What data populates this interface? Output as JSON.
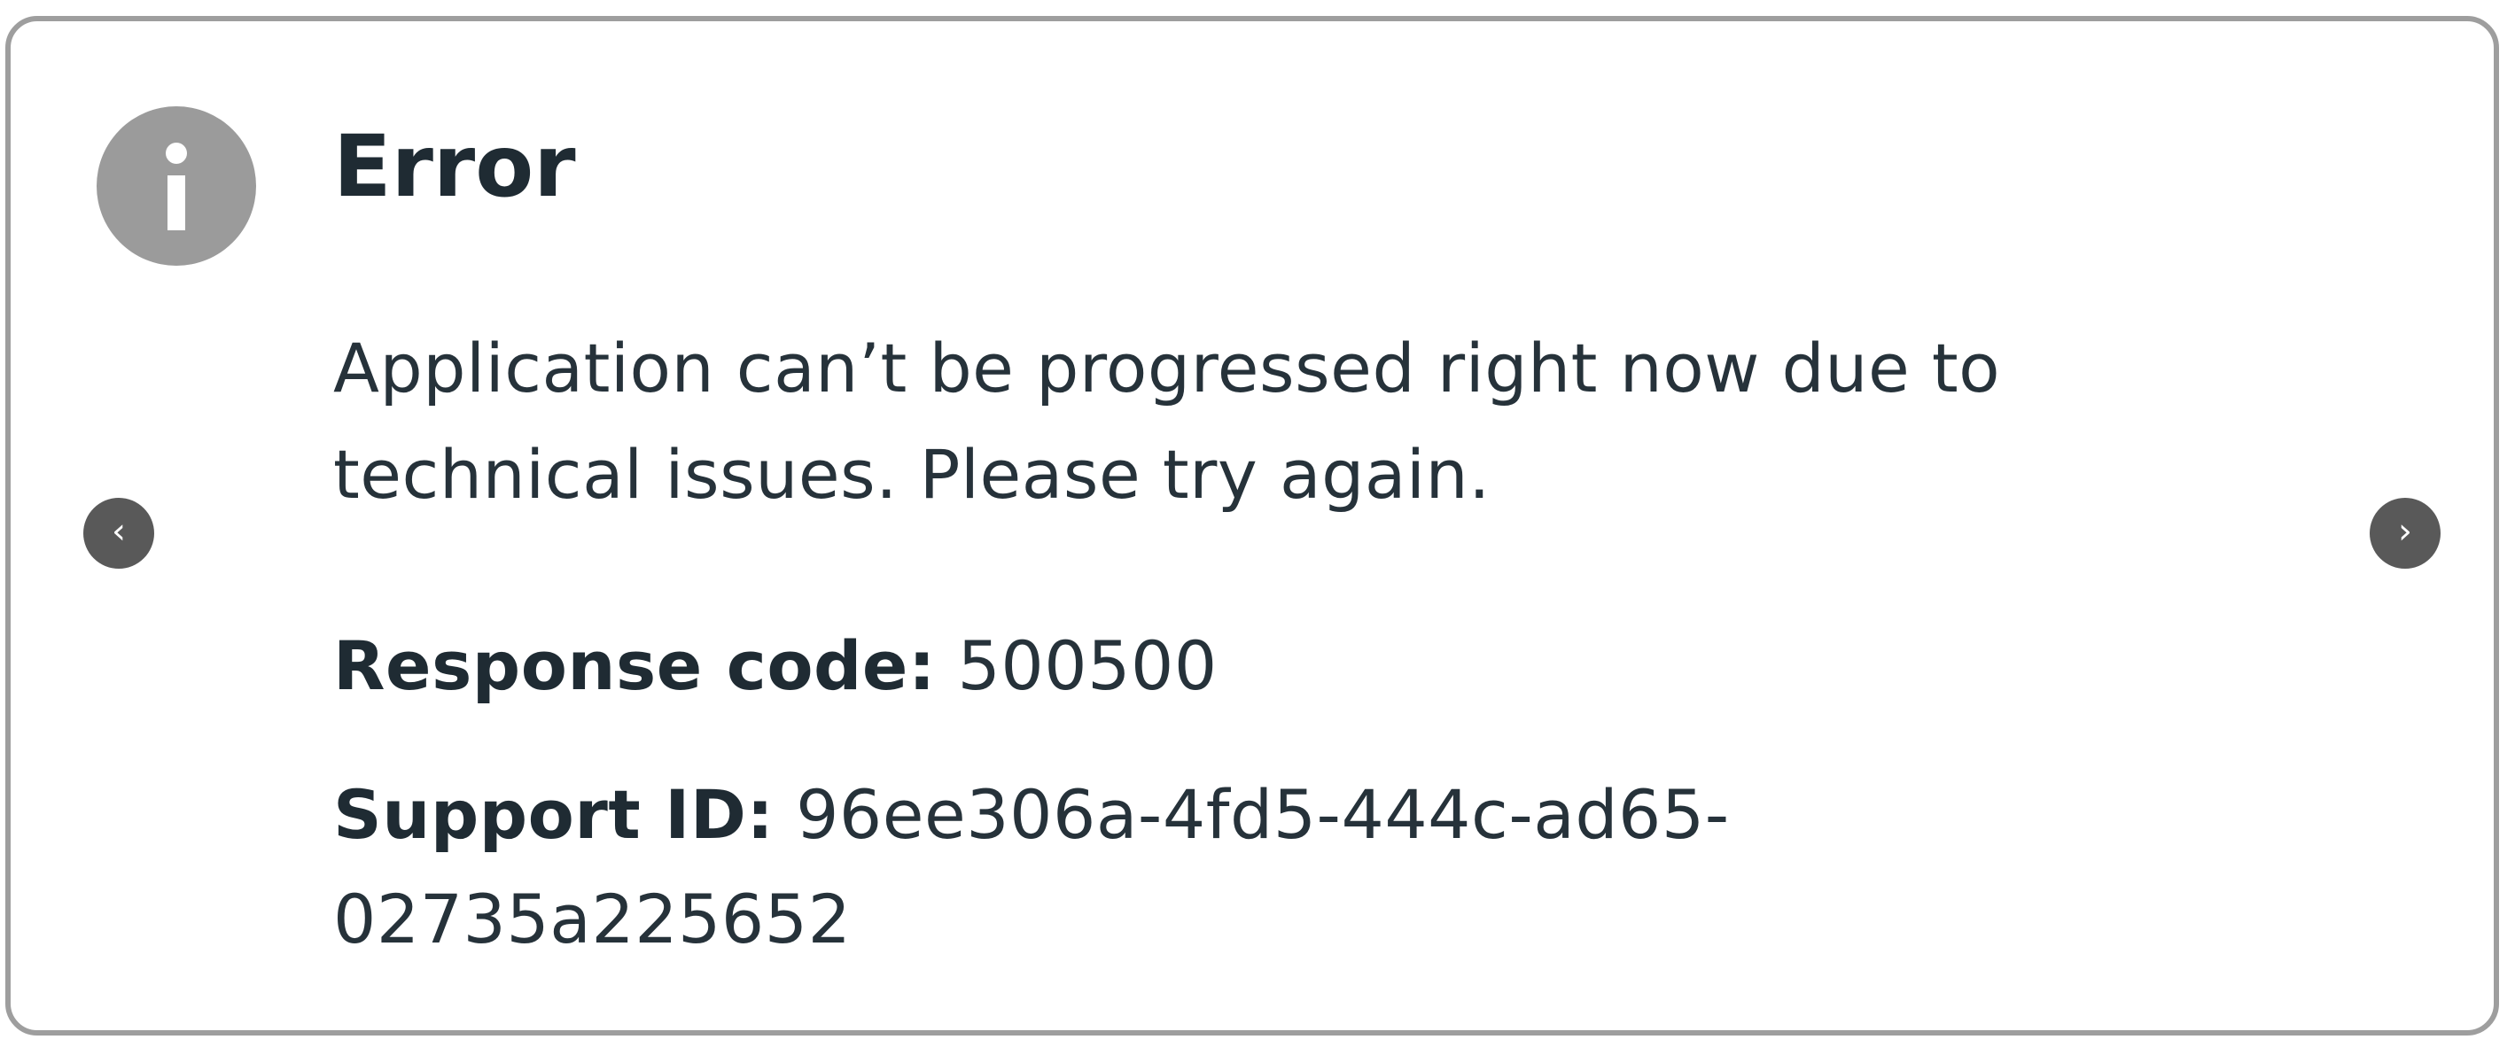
{
  "dialog": {
    "title": "Error",
    "message": "Application can’t be progressed right now due to technical issues. Please try again.",
    "response_code_label": "Response code:",
    "response_code_value": "500500",
    "support_id_label": "Support ID:",
    "support_id_value": "96ee306a-4fd5-444c-ad65-02735a225652"
  },
  "icons": {
    "status": "info-icon",
    "prev": "chevron-left-icon",
    "next": "chevron-right-icon"
  },
  "nav": {
    "prev_glyph": "‹",
    "next_glyph": "›"
  },
  "colors": {
    "border": "#9e9e9e",
    "icon_bg": "#9b9b9b",
    "nav_bg": "#595959",
    "text": "#26323a"
  }
}
